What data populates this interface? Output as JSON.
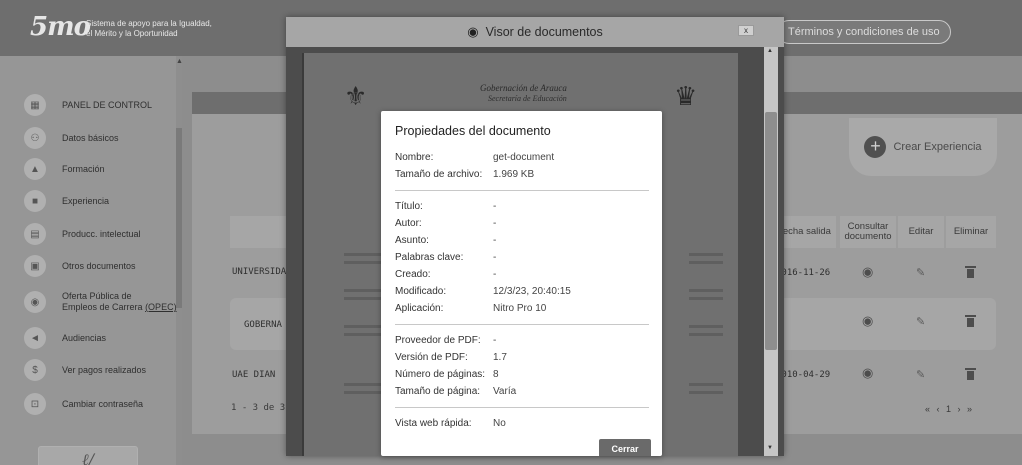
{
  "header": {
    "logo_mark": "5mo",
    "logo_text_line1": "Sistema de apoyo para la Igualdad,",
    "logo_text_line2": "el Mérito y la Oportunidad",
    "terms_button": "Términos y condiciones de uso"
  },
  "sidebar": {
    "items": [
      {
        "label": "PANEL DE CONTROL",
        "icon": "dashboard-icon",
        "glyph": "▦"
      },
      {
        "label": "Datos básicos",
        "icon": "people-icon",
        "glyph": "👥"
      },
      {
        "label": "Formación",
        "icon": "graduation-icon",
        "glyph": "🎓"
      },
      {
        "label": "Experiencia",
        "icon": "briefcase-icon",
        "glyph": "💼"
      },
      {
        "label": "Producc. intelectual",
        "icon": "book-icon",
        "glyph": "📘"
      },
      {
        "label": "Otros documentos",
        "icon": "document-icon",
        "glyph": "🗎"
      },
      {
        "label_line1": "Oferta Pública de",
        "label_line2": "Empleos de Carrera",
        "label_suffix": "(OPEC)",
        "icon": "globe-icon",
        "glyph": "◉"
      },
      {
        "label": "Audiencias",
        "icon": "megaphone-icon",
        "glyph": "📢"
      },
      {
        "label": "Ver pagos realizados",
        "icon": "dollar-icon",
        "glyph": "$"
      },
      {
        "label": "Cambiar contraseña",
        "icon": "lock-icon",
        "glyph": "🔒"
      }
    ],
    "signature_text": "ℓ∕"
  },
  "main": {
    "crear_button": "Crear Experiencia",
    "columns": {
      "fecha_salida": "Fecha salida",
      "consultar": "Consultar documento",
      "editar": "Editar",
      "eliminar": "Eliminar"
    },
    "rows": [
      {
        "entity": "UNIVERSIDA",
        "fecha_salida": "2016-11-26"
      },
      {
        "entity": "GOBERNA",
        "fecha_salida": ""
      },
      {
        "entity": "UAE DIAN",
        "fecha_salida": "2010-04-29"
      }
    ],
    "pager_info": "1 - 3 de 3",
    "pager": "« ‹ 1 › »"
  },
  "viewer": {
    "title": "Visor de documentos",
    "close_label": "x",
    "doc_heading1": "Gobernación de Arauca",
    "doc_heading2": "Secretaría de Educación"
  },
  "properties": {
    "title": "Propiedades del documento",
    "rows_file": [
      {
        "key": "Nombre:",
        "value": "get-document"
      },
      {
        "key": "Tamaño de archivo:",
        "value": "1.969 KB"
      }
    ],
    "rows_meta": [
      {
        "key": "Título:",
        "value": "-"
      },
      {
        "key": "Autor:",
        "value": "-"
      },
      {
        "key": "Asunto:",
        "value": "-"
      },
      {
        "key": "Palabras clave:",
        "value": "-"
      },
      {
        "key": "Creado:",
        "value": "-"
      },
      {
        "key": "Modificado:",
        "value": "12/3/23, 20:40:15"
      },
      {
        "key": "Aplicación:",
        "value": "Nitro Pro 10"
      }
    ],
    "rows_pdf": [
      {
        "key": "Proveedor de PDF:",
        "value": "-"
      },
      {
        "key": "Versión de PDF:",
        "value": "1.7"
      },
      {
        "key": "Número de páginas:",
        "value": "8"
      },
      {
        "key": "Tamaño de página:",
        "value": "Varía"
      }
    ],
    "rows_web": [
      {
        "key": "Vista web rápida:",
        "value": "No"
      }
    ],
    "close_button": "Cerrar"
  }
}
